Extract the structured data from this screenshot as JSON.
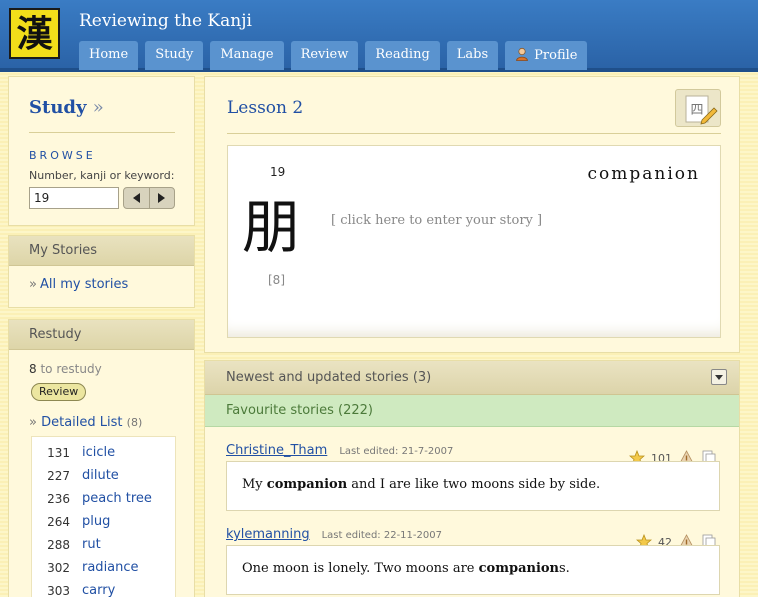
{
  "logo": {
    "glyph": "漢"
  },
  "site_title": "Reviewing the Kanji",
  "nav": [
    {
      "label": "Home"
    },
    {
      "label": "Study"
    },
    {
      "label": "Manage"
    },
    {
      "label": "Review"
    },
    {
      "label": "Reading"
    },
    {
      "label": "Labs"
    },
    {
      "label": "Profile",
      "icon": "user-icon"
    }
  ],
  "sidebar": {
    "study_title": "Study",
    "study_arrow": "»",
    "browse_label": "BROWSE",
    "keyword_label": "Number, kanji or keyword:",
    "keyword_value": "19",
    "my_stories": {
      "title": "My Stories",
      "link": "All my stories",
      "link_prefix": "»"
    },
    "restudy": {
      "title": "Restudy",
      "count": "8",
      "count_text": "to restudy",
      "review_button": "Review",
      "detailed_prefix": "»",
      "detailed_label": "Detailed List",
      "detailed_count": "(8)",
      "items": [
        {
          "num": "131",
          "keyword": "icicle"
        },
        {
          "num": "227",
          "keyword": "dilute"
        },
        {
          "num": "236",
          "keyword": "peach tree"
        },
        {
          "num": "264",
          "keyword": "plug"
        },
        {
          "num": "288",
          "keyword": "rut"
        },
        {
          "num": "302",
          "keyword": "radiance"
        },
        {
          "num": "303",
          "keyword": "carry"
        }
      ]
    }
  },
  "main": {
    "lesson_title": "Lesson 2",
    "edit_icon": "edit-kanji-icon",
    "edit_glyph": "四",
    "frame_number": "19",
    "kanji": "朋",
    "stroke_count": "[8]",
    "keyword": "companion",
    "story_placeholder": "[ click here to enter your story ]"
  },
  "stories": {
    "newest_label": "Newest and updated stories (3)",
    "favourite_label": "Favourite stories (222)",
    "items": [
      {
        "author": "Christine_Tham",
        "edited": "Last edited: 21-7-2007",
        "stars": "101",
        "pre": "My ",
        "bold": "companion",
        "post": " and I are like two moons side by side."
      },
      {
        "author": "kylemanning",
        "edited": "Last edited: 22-11-2007",
        "stars": "42",
        "pre": "One moon is lonely. Two moons are ",
        "bold": "companion",
        "post": "s."
      }
    ]
  },
  "colors": {
    "header": "#2e6bb0",
    "nav_tab": "#5a93cf",
    "link": "#2150a4",
    "favourite_bg": "#cfeac0",
    "panel_bg": "#fff9dc"
  }
}
